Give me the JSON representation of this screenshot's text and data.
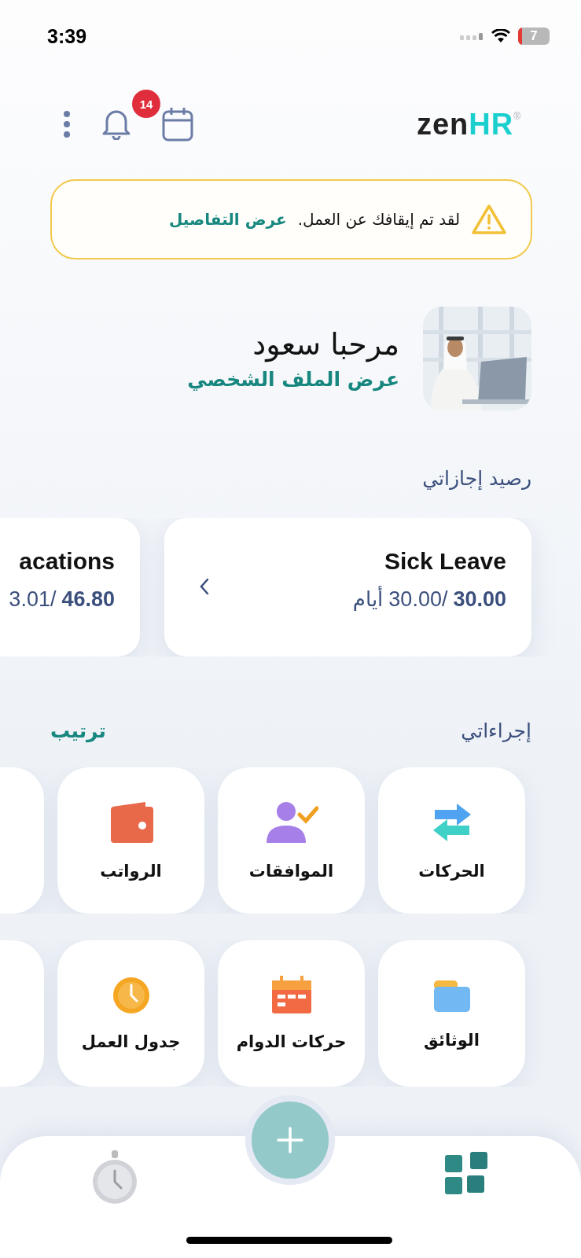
{
  "status_bar": {
    "time": "3:39",
    "battery": "7"
  },
  "header": {
    "logo": {
      "word": "zen",
      "accent": "HR",
      "mark": "®"
    },
    "notifications": {
      "count": "14"
    }
  },
  "alert": {
    "message": "لقد تم إيقافك عن العمل.",
    "link": "عرض التفاصيل"
  },
  "profile": {
    "greeting": "مرحبا سعود",
    "link": "عرض الملف الشخصي"
  },
  "leave_balance": {
    "title": "رصيد إجازاتي",
    "cards": [
      {
        "name": "Sick Leave",
        "used": "30.00",
        "total": "30.00/",
        "unit": "أيام"
      },
      {
        "name": "acations",
        "used": "46.80",
        "total": "3.01/"
      }
    ]
  },
  "actions": {
    "title": "إجراءاتي",
    "sort_link": "ترتيب",
    "rows": [
      [
        {
          "label": "الحركات",
          "kind": "transfer"
        },
        {
          "label": "الموافقات",
          "kind": "approval"
        },
        {
          "label": "الرواتب",
          "kind": "wallet"
        }
      ],
      [
        {
          "label": "الوثائق",
          "kind": "folder"
        },
        {
          "label": "حركات الدوام",
          "kind": "calendar"
        },
        {
          "label": "جدول العمل",
          "kind": "clock"
        }
      ]
    ]
  }
}
